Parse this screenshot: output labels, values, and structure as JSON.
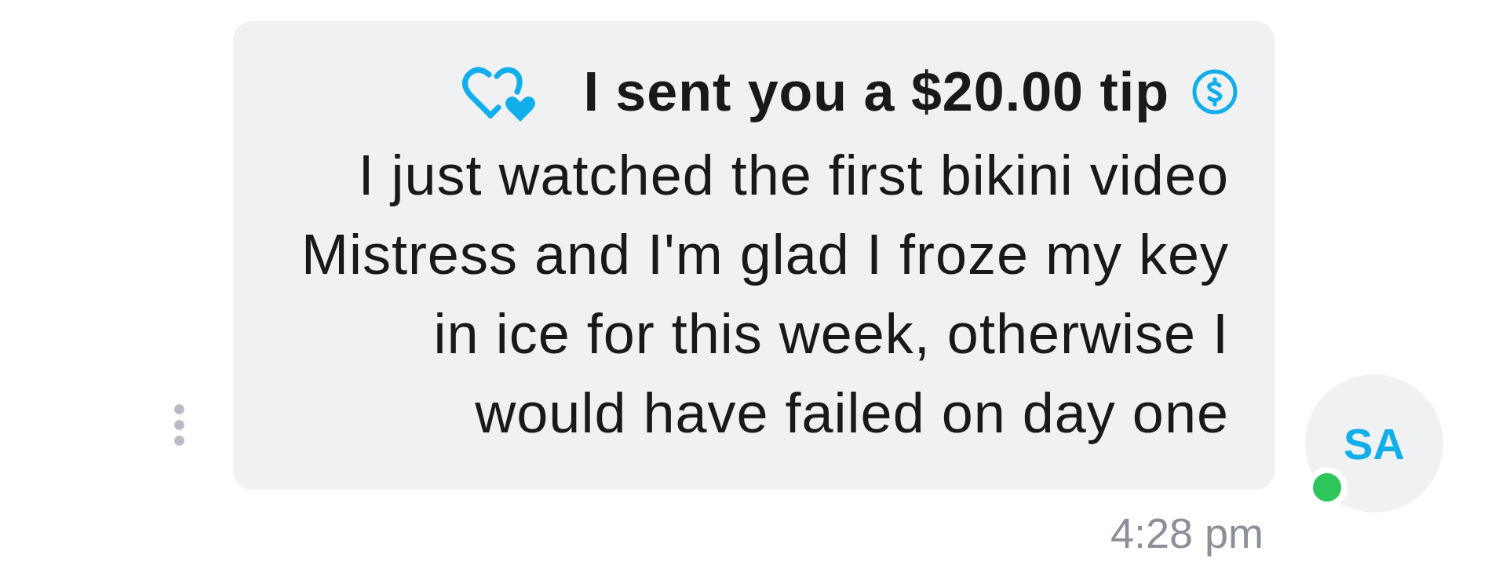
{
  "message": {
    "tip_title": "I sent you a $20.00 tip",
    "text": "I just watched the first bikini video Mistress and I'm glad I froze my key in ice for this week, otherwise I would have failed on day one",
    "time": "4:28 pm"
  },
  "sender": {
    "initials": "SA",
    "online": true
  }
}
